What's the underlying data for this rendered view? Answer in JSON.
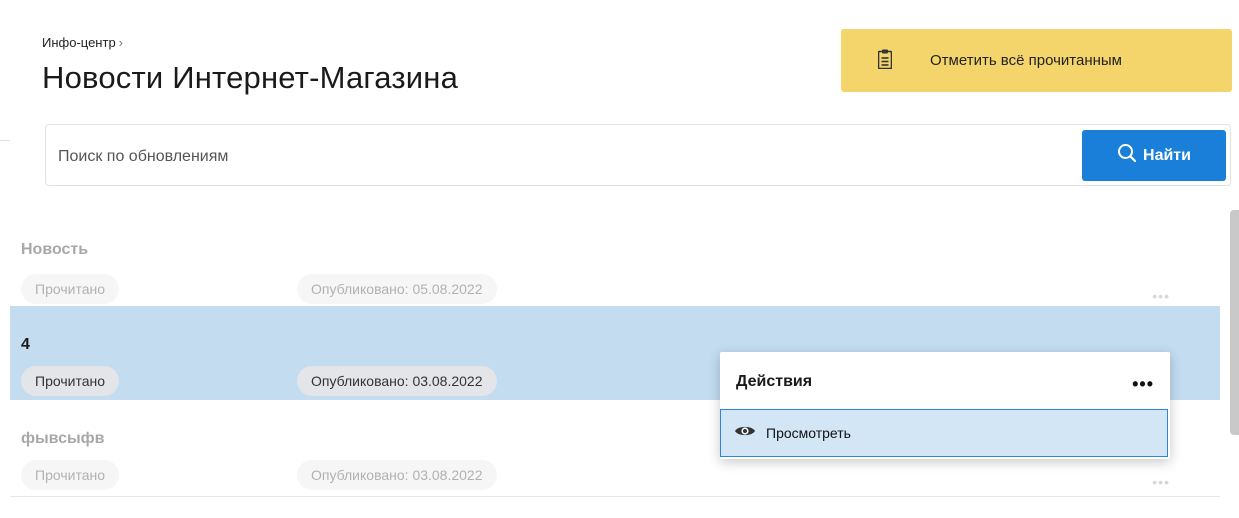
{
  "breadcrumb": {
    "item": "Инфо-центр",
    "separator": "›"
  },
  "page_title": "Новости Интернет-Магазина",
  "mark_all": {
    "label": "Отметить всё прочитанным",
    "icon": "clipboard-icon",
    "color": "#f3d56c"
  },
  "search": {
    "placeholder": "Поиск по обновлениям",
    "value": "",
    "button_label": "Найти",
    "button_color": "#1a7fd8"
  },
  "news": [
    {
      "title": "Новость",
      "status": "Прочитано",
      "published": "Опубликовано: 05.08.2022",
      "more": "•••"
    },
    {
      "title": "4",
      "status": "Прочитано",
      "published": "Опубликовано: 03.08.2022",
      "more": "•••",
      "selected": true
    },
    {
      "title": "фывсыфв",
      "status": "Прочитано",
      "published": "Опубликовано: 03.08.2022",
      "more": "•••"
    }
  ],
  "actions_menu": {
    "title": "Действия",
    "more": "•••",
    "items": [
      {
        "label": "Просмотреть",
        "icon": "eye-icon"
      }
    ]
  },
  "colors": {
    "selected_row": "#c3dcf0",
    "menu_item_highlight": "#d3e6f6"
  }
}
